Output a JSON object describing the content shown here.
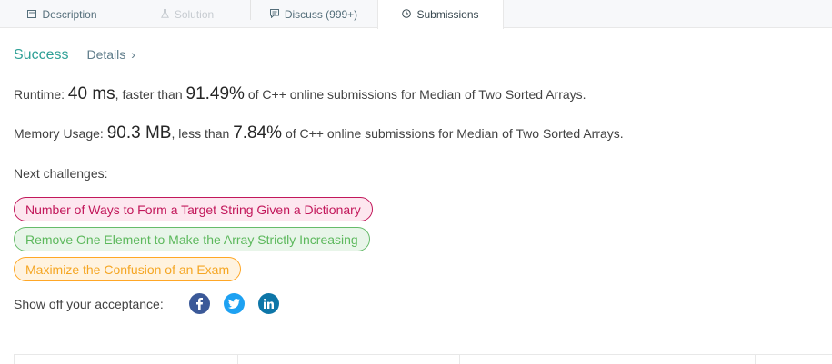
{
  "tabs": [
    {
      "label": "Description",
      "icon": "description-icon"
    },
    {
      "label": "Solution",
      "icon": "flask-icon"
    },
    {
      "label": "Discuss (999+)",
      "icon": "discuss-icon"
    },
    {
      "label": "Submissions",
      "icon": "clock-icon"
    }
  ],
  "result": {
    "status": "Success",
    "details_label": "Details",
    "details_chevron": "›"
  },
  "runtime": {
    "label": "Runtime:",
    "value": "40 ms",
    "comparison": ", faster than",
    "percent": "91.49%",
    "suffix": "of C++ online submissions for Median of Two Sorted Arrays."
  },
  "memory": {
    "label": "Memory Usage:",
    "value": "90.3 MB",
    "comparison": ", less than",
    "percent": "7.84%",
    "suffix": "of C++ online submissions for Median of Two Sorted Arrays."
  },
  "next": {
    "label": "Next challenges:",
    "challenges": [
      {
        "title": "Number of Ways to Form a Target String Given a Dictionary",
        "difficulty": "hard",
        "color": "#c2185b"
      },
      {
        "title": "Remove One Element to Make the Array Strictly Increasing",
        "difficulty": "easy",
        "color": "#5cb85c"
      },
      {
        "title": "Maximize the Confusion of an Exam",
        "difficulty": "medium",
        "color": "#f5a623"
      }
    ]
  },
  "share": {
    "label": "Show off your acceptance:",
    "networks": [
      "facebook-icon",
      "twitter-icon",
      "linkedin-icon"
    ]
  }
}
